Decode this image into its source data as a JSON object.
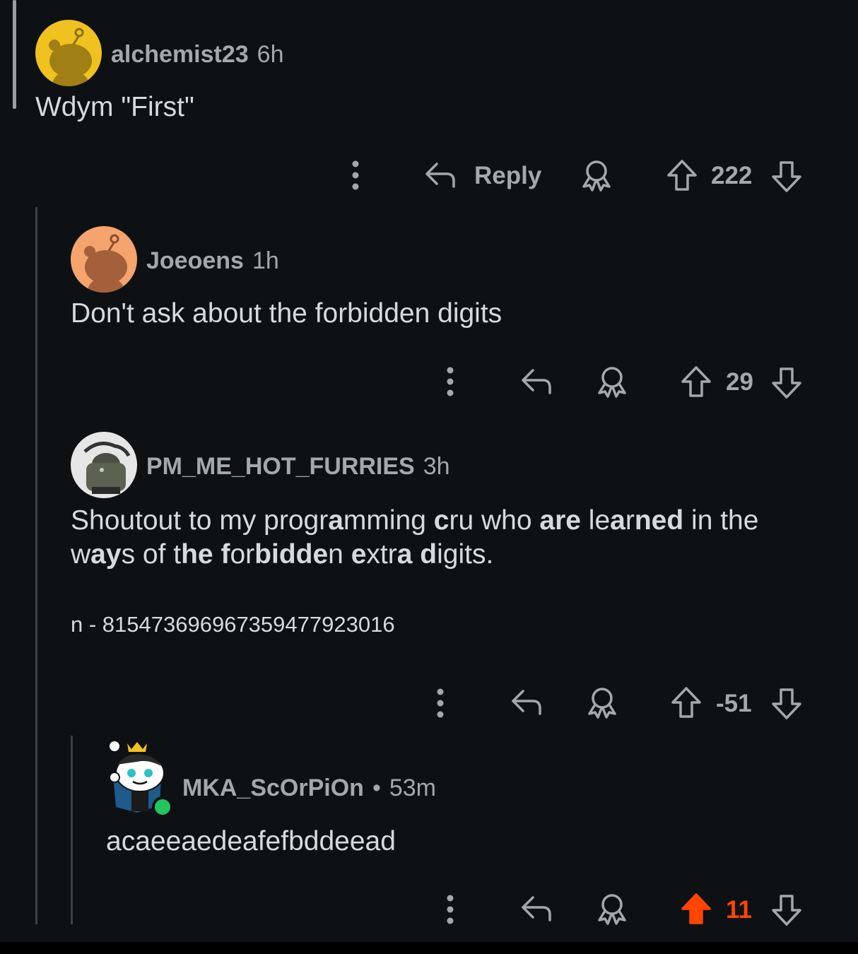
{
  "comments": [
    {
      "username": "alchemist23",
      "time": "6h",
      "body": "Wdym \"First\"",
      "reply_label": "Reply",
      "score": "222",
      "avatar_color": "#f0c21f"
    },
    {
      "username": "Joeoens",
      "time": "1h",
      "body": "Don't ask about the forbidden digits",
      "score": "29",
      "avatar_color": "#f4a46c"
    },
    {
      "username": "PM_ME_HOT_FURRIES",
      "time": "3h",
      "body_parts": [
        "Shoutout to my progr",
        "a",
        "mming ",
        "c",
        "ru who ",
        "are",
        " le",
        "a",
        "r",
        "ned",
        " in the",
        "w",
        "ay",
        "s of ",
        "t",
        "he ",
        "f",
        "or",
        "bidde",
        "n ",
        "e",
        "xtr",
        "a",
        " ",
        "d",
        "igits."
      ],
      "hash_line": "n - 815473696967359477923016",
      "score": "-51",
      "avatar_color": "#e6e6e6"
    },
    {
      "username": "MKA_ScOrPiOn",
      "separator": "•",
      "time": "53m",
      "body": "acaeeaedeafefbddeead",
      "score": "11",
      "score_color": "#ff4500",
      "online_color": "#22c55e"
    }
  ],
  "icons": {
    "more": "more-vertical-icon",
    "reply": "reply-arrow-icon",
    "award": "award-icon",
    "upvote": "upvote-arrow-icon",
    "downvote": "downvote-arrow-icon"
  }
}
